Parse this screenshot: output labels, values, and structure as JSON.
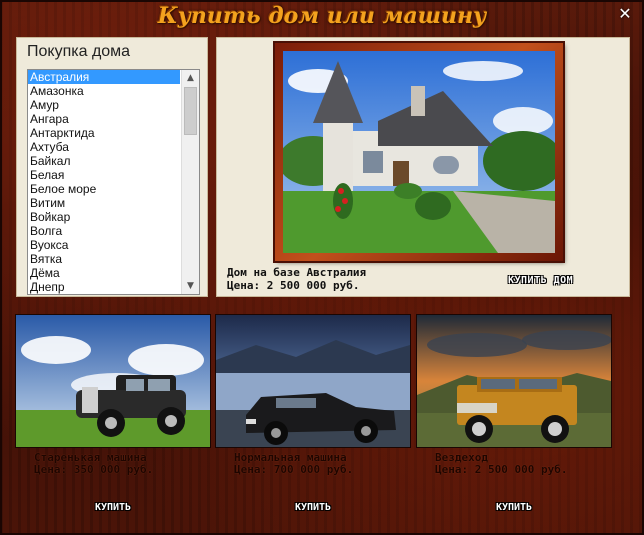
{
  "window": {
    "title": "Купить дом или машину",
    "close_symbol": "✕"
  },
  "house_list": {
    "heading": "Покупка дома",
    "items": [
      "Австралия",
      "Амазонка",
      "Амур",
      "Ангара",
      "Антарктида",
      "Ахтуба",
      "Байкал",
      "Белая",
      "Белое море",
      "Витим",
      "Войкар",
      "Волга",
      "Вуокса",
      "Вятка",
      "Дёма",
      "Днепр"
    ],
    "selected_index": 0
  },
  "house_preview": {
    "name_line": "Дом на базе Австралия",
    "price_line": "Цена: 2 500 000 руб.",
    "buy_label": "КУПИТЬ ДОМ"
  },
  "cars": [
    {
      "name": "Старенькая машина",
      "price": "Цена: 350 000 руб.",
      "buy_label": "КУПИТЬ"
    },
    {
      "name": "Нормальная машина",
      "price": "Цена: 700 000 руб.",
      "buy_label": "КУПИТЬ"
    },
    {
      "name": "Вездеход",
      "price": "Цена: 2 500 000 руб.",
      "buy_label": "КУПИТЬ"
    }
  ],
  "colors": {
    "title": "#f3a21e",
    "selection": "#3399ff",
    "panel": "#efeada"
  }
}
